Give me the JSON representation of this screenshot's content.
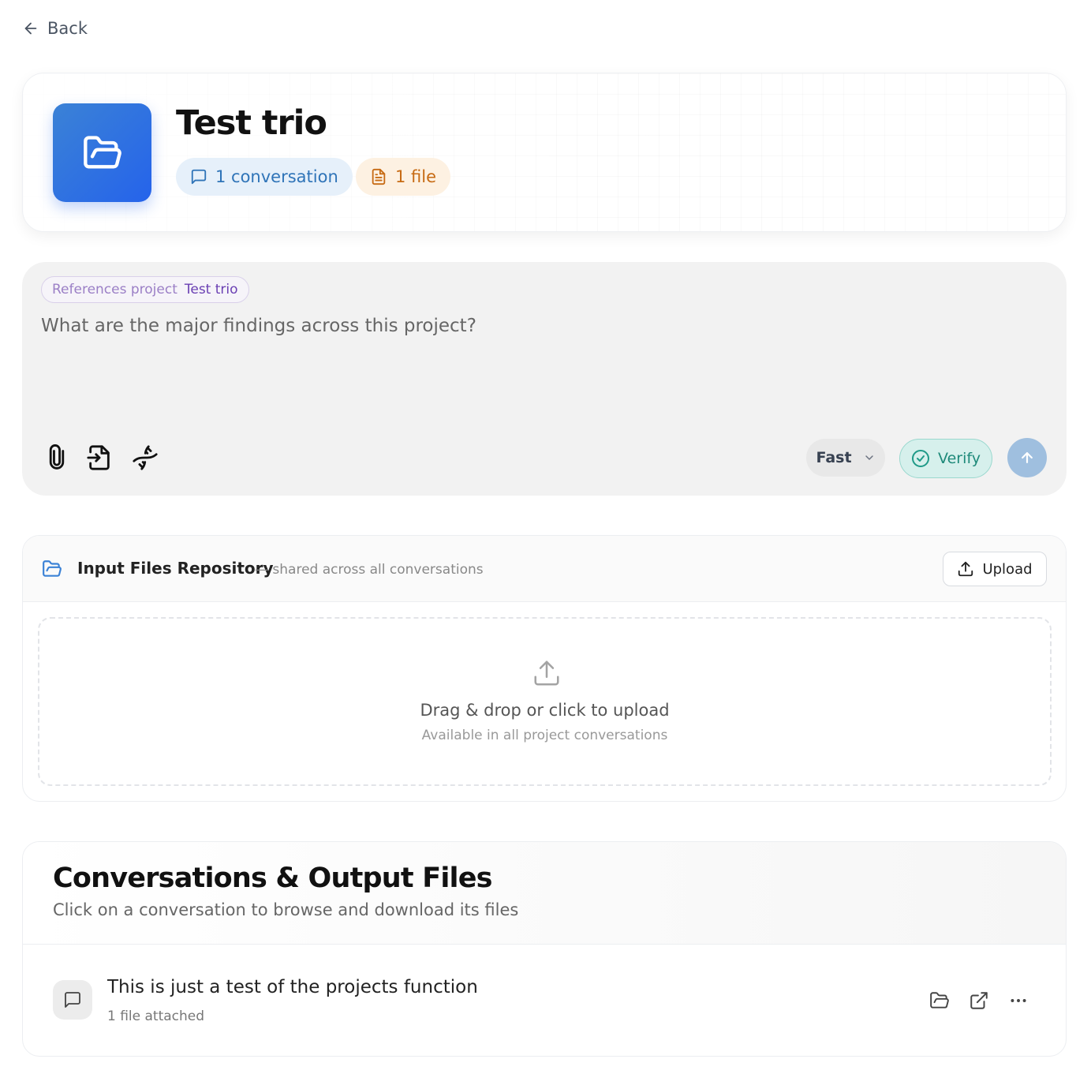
{
  "nav": {
    "back_label": "Back"
  },
  "project": {
    "title": "Test trio",
    "conversations_badge": "1 conversation",
    "files_badge": "1 file",
    "icon": "folder-open-icon",
    "accent_color": "#2563eb"
  },
  "composer": {
    "reference_label": "References project",
    "reference_value": "Test trio",
    "prompt_text": "What are the major findings across this project?",
    "tools": [
      "paperclip-icon",
      "file-import-icon",
      "dna-icon"
    ],
    "mode_label": "Fast",
    "verify_label": "Verify",
    "send_icon": "arrow-up-icon"
  },
  "repository": {
    "title": "Input Files Repository",
    "subtitle": "— shared across all conversations",
    "upload_label": "Upload",
    "dropzone_title": "Drag & drop or click to upload",
    "dropzone_subtitle": "Available in all project conversations"
  },
  "conversations": {
    "title": "Conversations & Output Files",
    "subtitle": "Click on a conversation to browse and download its files",
    "items": [
      {
        "name": "This is just a test of the projects function",
        "meta": "1 file attached"
      }
    ]
  }
}
